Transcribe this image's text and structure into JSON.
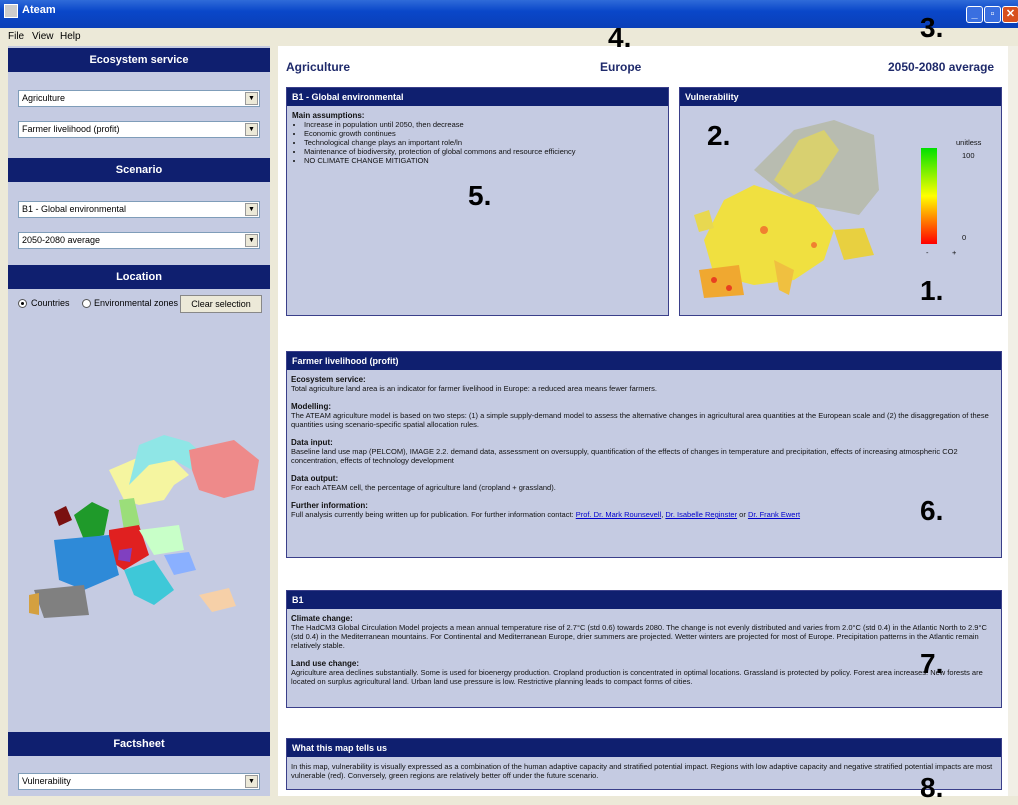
{
  "window": {
    "title": "Ateam"
  },
  "menu": [
    "File",
    "View",
    "Help"
  ],
  "left": {
    "ecosystem_header": "Ecosystem service",
    "ecosystem_select_1": "Agriculture",
    "ecosystem_select_2": "Farmer livelihood (profit)",
    "scenario_header": "Scenario",
    "scenario_select_1": "B1 - Global environmental",
    "scenario_select_2": "2050-2080 average",
    "location_header": "Location",
    "radio_countries": "Countries",
    "radio_env_zones": "Environmental zones",
    "clear_button": "Clear selection",
    "factsheet_header": "Factsheet",
    "factsheet_select": "Vulnerability"
  },
  "header": {
    "service": "Agriculture",
    "region": "Europe",
    "period": "2050-2080 average"
  },
  "assumptions_panel": {
    "title": "B1 - Global environmental",
    "heading": "Main assumptions:",
    "items": [
      "Increase in population until 2050, then decrease",
      "Economic growth continues",
      "Technological change plays an important role/ln",
      "Maintenance of biodiversity, protection of global commons and resource efficiency",
      "NO CLIMATE CHANGE MITIGATION"
    ]
  },
  "vulnerability_panel": {
    "title": "Vulnerability",
    "legend_unit": "unitless",
    "legend_max": "100",
    "legend_min": "0",
    "legend_minus": "-",
    "legend_plus": "+"
  },
  "farmer_panel": {
    "title": "Farmer livelihood (profit)",
    "s1_head": "Ecosystem service:",
    "s1_body": "Total agriculture land area is an indicator for farmer livelihood in Europe: a reduced area means fewer farmers.",
    "s2_head": "Modelling:",
    "s2_body": "The ATEAM agriculture model is based on two steps: (1) a simple supply-demand model to assess the alternative changes in agricultural area quantities at the European scale and (2) the disaggregation of these quantities using scenario-specific spatial allocation rules.",
    "s3_head": "Data input:",
    "s3_body": "Baseline land use map (PELCOM), IMAGE 2.2. demand data, assessment on oversupply, quantification of the effects of changes in temperature and precipitation, effects of increasing atmospheric CO2 concentration, effects of technology development",
    "s4_head": "Data output:",
    "s4_body": "For each ATEAM cell, the percentage of agriculture land (cropland + grassland).",
    "s5_head": "Further information:",
    "s5_body": "Full analysis currently being written up for publication. For further information contact:",
    "link1": "Prof. Dr. Mark Rounsevell",
    "sep1": ",",
    "link2": "Dr. Isabelle Reginster",
    "sep2": "or",
    "link3": "Dr. Frank Ewert"
  },
  "b1_panel": {
    "title": "B1",
    "s1_head": "Climate change:",
    "s1_body": "The HadCM3 Global Circulation Model projects a mean annual temperature rise of 2.7°C (std 0.6) towards 2080. The change is not evenly distributed and varies from 2.0°C (std 0.4) in the Atlantic North to 2.9°C (std 0.4) in the Mediterranean mountains. For Continental and Mediterranean Europe, drier summers are projected. Wetter winters are projected for most of Europe. Precipitation patterns in the Atlantic remain relatively stable.",
    "s2_head": "Land use change:",
    "s2_body": "Agriculture area declines substantially. Some is used for bioenergy production. Cropland production is concentrated in optimal locations. Grassland is protected by policy. Forest area increases. New forests are located on surplus agricultural land. Urban land use pressure is low. Restrictive planning leads to compact forms of cities."
  },
  "map_tells_panel": {
    "title": "What this map tells us",
    "body": "In this map, vulnerability is visually expressed as a combination of the human adaptive capacity and stratified potential impact. Regions with low adaptive capacity and negative stratified potential impacts are most vulnerable (red). Conversely, green regions are relatively better off under the future scenario."
  },
  "annotations": [
    "1.",
    "2.",
    "3.",
    "4.",
    "5.",
    "6.",
    "7.",
    "8."
  ]
}
